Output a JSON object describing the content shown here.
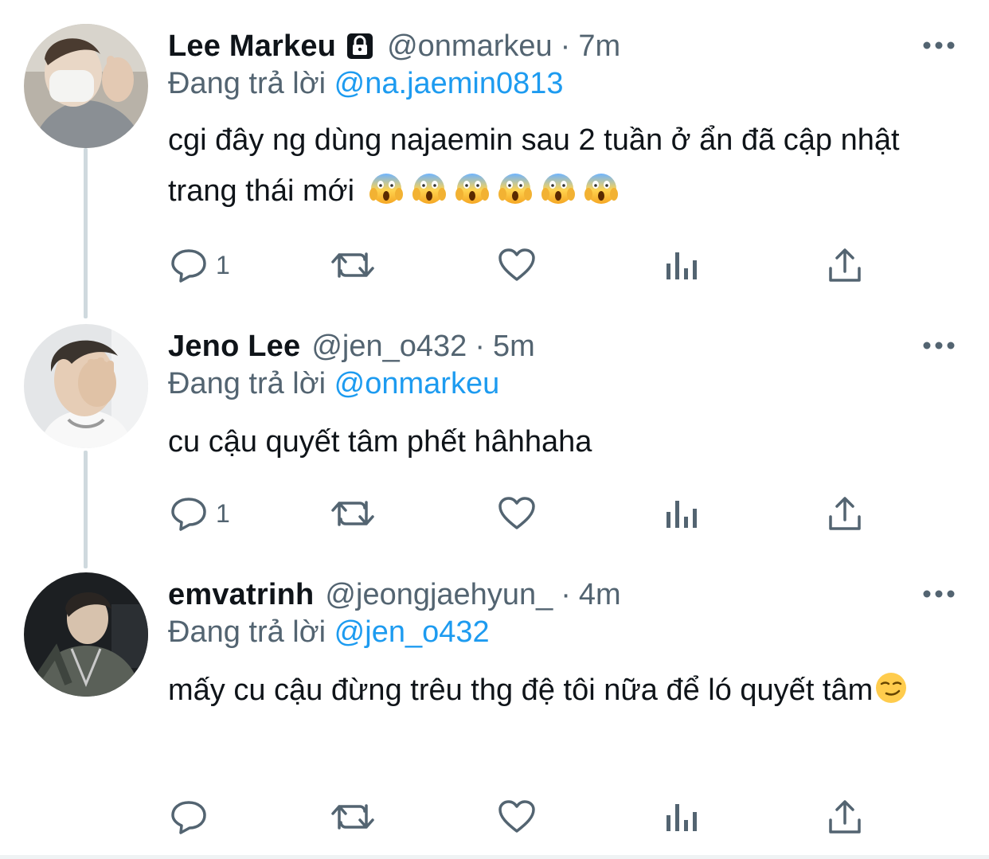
{
  "colors": {
    "text": "#0f1419",
    "muted": "#536471",
    "link": "#1d9bf0",
    "thread_line": "#cfd9de"
  },
  "reply_prefix": "Đang trả lời",
  "tweets": [
    {
      "display_name": "Lee Markeu",
      "protected_icon": "lock-icon",
      "handle": "@onmarkeu",
      "separator": "·",
      "time": "7m",
      "reply_to": "@na.jaemin0813",
      "text": "cgi đây ng dùng najaemin sau 2 tuần ở ẩn đã cập nhật trang thái mới",
      "emoji": [
        "😱",
        "😱",
        "😱",
        "😱",
        "😱",
        "😱"
      ],
      "actions": {
        "reply_count": "1",
        "retweet_count": "",
        "like_count": ""
      }
    },
    {
      "display_name": "Jeno Lee",
      "handle": "@jen_o432",
      "separator": "·",
      "time": "5m",
      "reply_to": "@onmarkeu",
      "text": "cu cậu quyết tâm phết hâhhaha",
      "actions": {
        "reply_count": "1",
        "retweet_count": "",
        "like_count": ""
      }
    },
    {
      "display_name": "emvatrinh",
      "handle": "@jeongjaehyun_",
      "separator": "·",
      "time": "4m",
      "reply_to": "@jen_o432",
      "text": "mấy cu cậu đừng trêu thg đệ tôi nữa để ló quyết tâm",
      "emoji": [
        "😏"
      ],
      "actions": {
        "reply_count": "",
        "retweet_count": "",
        "like_count": ""
      }
    }
  ],
  "icons": {
    "more": "more-horizontal-icon",
    "reply": "reply-bubble-icon",
    "retweet": "retweet-icon",
    "like": "heart-icon",
    "views": "analytics-bars-icon",
    "share": "share-icon"
  }
}
